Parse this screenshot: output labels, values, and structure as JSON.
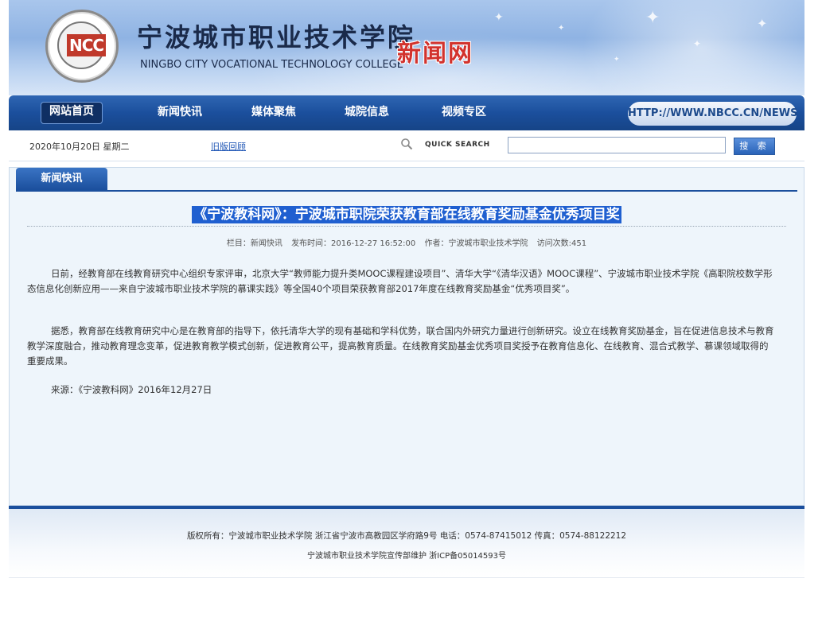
{
  "header": {
    "title_cn": "宁波城市职业技术学院",
    "title_en": "NINGBO CITY VOCATIONAL TECHNOLOGY COLLEGE",
    "site_name": "新闻网",
    "logo_text": "NCC"
  },
  "nav": {
    "items": [
      "网站首页",
      "新闻快讯",
      "媒体聚焦",
      "城院信息",
      "视频专区"
    ],
    "active": "网站首页",
    "url": "HTTP://WWW.NBCC.CN/NEWS"
  },
  "toolbar": {
    "date": "2020年10月20日 星期二",
    "old_version": "旧版回顾",
    "search_label": "QUICK SEARCH",
    "search_value": "",
    "search_button": "搜 索"
  },
  "section": {
    "tab": "新闻快讯"
  },
  "article": {
    "title": "《宁波教科网》：宁波城市职院荣获教育部在线教育奖励基金优秀项目奖",
    "meta": {
      "column": "栏目：新闻快讯",
      "published": "发布时间：2016-12-27 16:52:00",
      "author": "作者：宁波城市职业技术学院",
      "visits": "访问次数:451"
    },
    "paragraphs": [
      "日前，经教育部在线教育研究中心组织专家评审，北京大学“教师能力提升类MOOC课程建设项目”、清华大学“《清华汉语》MOOC课程”、宁波城市职业技术学院《高职院校数学形态信息化创新应用——来自宁波城市职业技术学院的慕课实践》等全国40个项目荣获教育部2017年度在线教育奖励基金“优秀项目奖”。",
      "据悉，教育部在线教育研究中心是在教育部的指导下，依托清华大学的现有基础和学科优势，联合国内外研究力量进行创新研究。设立在线教育奖励基金，旨在促进信息技术与教育教学深度融合，推动教育理念变革，促进教育教学模式创新，促进教育公平，提高教育质量。在线教育奖励基金优秀项目奖授予在教育信息化、在线教育、混合式教学、慕课领域取得的重要成果。",
      "来源：《宁波教科网》2016年12月27日"
    ]
  },
  "footer": {
    "line1": "版权所有：宁波城市职业技术学院 浙江省宁波市高教园区学府路9号 电话：0574-87415012 传真：0574-88122212",
    "line2": "宁波城市职业技术学院宣传部维护 浙ICP备05014593号"
  }
}
